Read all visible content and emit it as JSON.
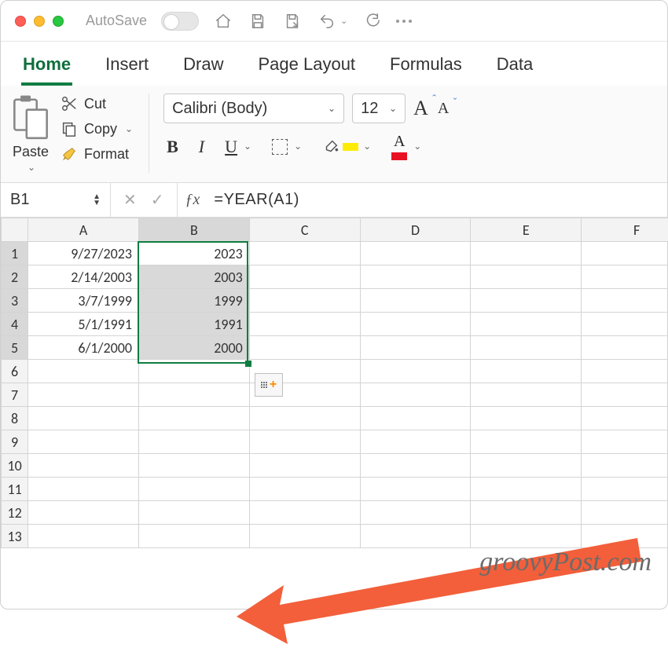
{
  "titlebar": {
    "autosave_label": "AutoSave"
  },
  "ribbon_tabs": [
    "Home",
    "Insert",
    "Draw",
    "Page Layout",
    "Formulas",
    "Data"
  ],
  "active_tab": "Home",
  "clipboard": {
    "paste_label": "Paste",
    "cut_label": "Cut",
    "copy_label": "Copy",
    "format_label": "Format"
  },
  "font": {
    "name": "Calibri (Body)",
    "size": "12"
  },
  "name_box": "B1",
  "formula": "=YEAR(A1)",
  "columns": [
    "A",
    "B",
    "C",
    "D",
    "E",
    "F"
  ],
  "data": {
    "A": [
      "9/27/2023",
      "2/14/2003",
      "3/7/1999",
      "5/1/1991",
      "6/1/2000"
    ],
    "B": [
      "2023",
      "2003",
      "1999",
      "1991",
      "2000"
    ]
  },
  "selection": {
    "col": "B",
    "rows": [
      1,
      5
    ],
    "active": "B1"
  },
  "watermark": "groovyPost.com"
}
